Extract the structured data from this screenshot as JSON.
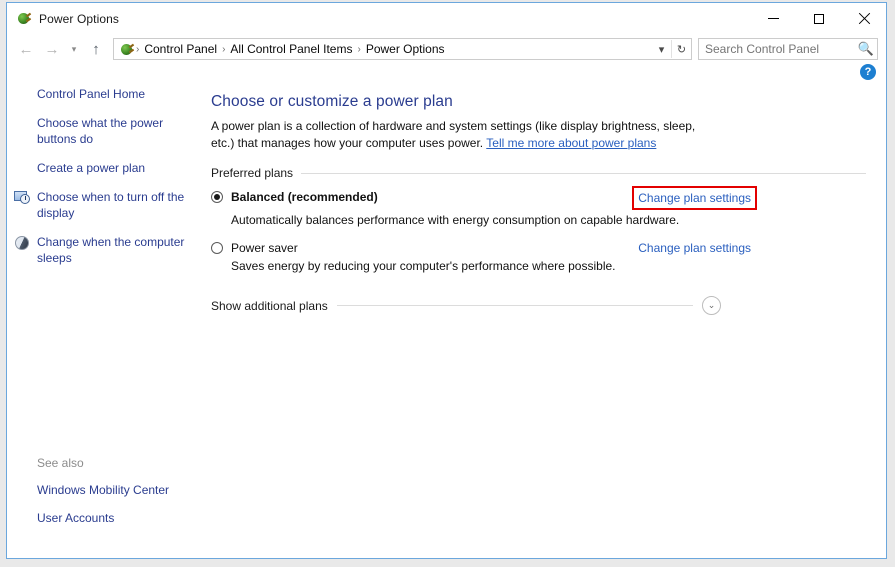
{
  "window": {
    "title": "Power Options",
    "app_icon": "power-plug-icon",
    "controls": {
      "minimize": "minimize-icon",
      "maximize": "maximize-icon",
      "close": "close-icon"
    }
  },
  "toolbar": {
    "back": "back-arrow-icon",
    "forward": "forward-arrow-icon",
    "recent": "chevron-down-icon",
    "up": "up-arrow-icon",
    "breadcrumbs": [
      "Control Panel",
      "All Control Panel Items",
      "Power Options"
    ],
    "separator": "›",
    "address_dropdown": "chevron-down-icon",
    "refresh": "refresh-icon",
    "refresh_glyph": "↻"
  },
  "search": {
    "placeholder": "Search Control Panel",
    "value": "",
    "icon": "search-icon"
  },
  "help": {
    "label": "?",
    "icon": "help-icon"
  },
  "sidebar": {
    "items": [
      {
        "label": "Control Panel Home",
        "icon": null
      },
      {
        "label": "Choose what the power buttons do",
        "icon": null
      },
      {
        "label": "Create a power plan",
        "icon": null
      },
      {
        "label": "Choose when to turn off the display",
        "icon": "display-clock-icon"
      },
      {
        "label": "Change when the computer sleeps",
        "icon": "moon-sleep-icon"
      }
    ],
    "see_also": {
      "title": "See also",
      "items": [
        "Windows Mobility Center",
        "User Accounts"
      ]
    }
  },
  "main": {
    "heading": "Choose or customize a power plan",
    "intro_text": "A power plan is a collection of hardware and system settings (like display brightness, sleep, etc.) that manages how your computer uses power.",
    "intro_link": "Tell me more about power plans",
    "group_label": "Preferred plans",
    "plans": [
      {
        "name": "Balanced (recommended)",
        "description": "Automatically balances performance with energy consumption on capable hardware.",
        "selected": true,
        "bold": true,
        "action_label": "Change plan settings",
        "highlighted": true
      },
      {
        "name": "Power saver",
        "description": "Saves energy by reducing your computer's performance where possible.",
        "selected": false,
        "bold": false,
        "action_label": "Change plan settings",
        "highlighted": false
      }
    ],
    "additional": {
      "label": "Show additional plans",
      "expander_icon": "chevron-down-icon",
      "expander_glyph": "⌄"
    }
  },
  "colors": {
    "window_border": "#6ba7dd",
    "heading_blue": "#2a3c8f",
    "link_blue": "#2a5fbf",
    "highlight_red": "#e30000",
    "desktop": "#e9e9e9"
  }
}
